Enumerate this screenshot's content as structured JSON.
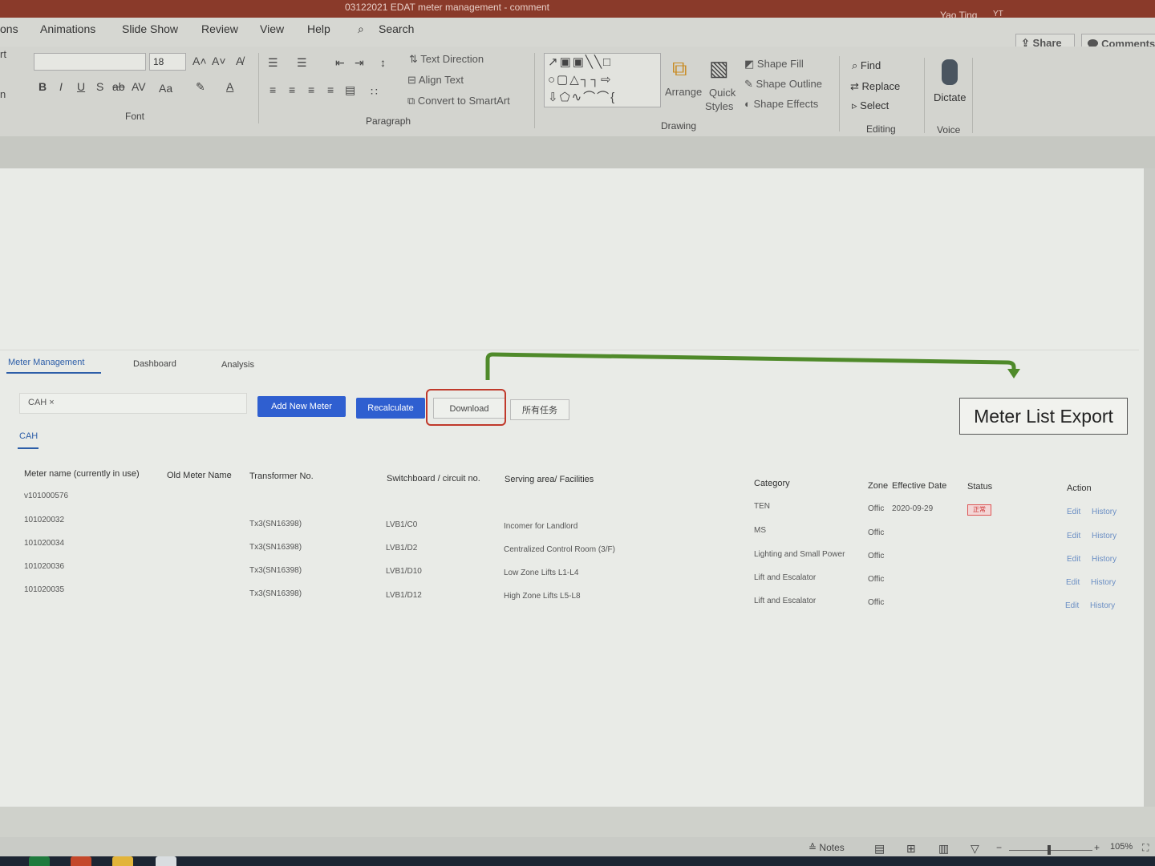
{
  "window": {
    "title": "03122021 EDAT meter management - comment",
    "user": "Yao Ting",
    "user_initials": "YT"
  },
  "ribbon_tabs": [
    "ons",
    "Animations",
    "Slide Show",
    "Review",
    "View",
    "Help",
    "Search"
  ],
  "share": "Share",
  "comments": "Comments",
  "ribbon": {
    "font_size": "18",
    "groups": {
      "font": "Font",
      "paragraph": "Paragraph",
      "drawing": "Drawing",
      "editing": "Editing",
      "voice": "Voice"
    },
    "paragraph_items": [
      "Text Direction",
      "Align Text",
      "Convert to SmartArt"
    ],
    "drawing_items": {
      "arrange": "Arrange",
      "quick": "Quick",
      "styles": "Styles",
      "shape_fill": "Shape Fill",
      "shape_outline": "Shape Outline",
      "shape_effects": "Shape Effects"
    },
    "editing_items": [
      "Find",
      "Replace",
      "Select"
    ],
    "dictate": "Dictate",
    "left_stub_1": "rt",
    "left_stub_2": "n"
  },
  "app": {
    "tabs": [
      "Meter Management",
      "Dashboard",
      "Analysis"
    ],
    "filter_chip": "CAH ×",
    "buttons": {
      "add": "Add New Meter",
      "recalc": "Recalculate",
      "download": "Download",
      "task": "所有任务"
    },
    "subtab": "CAH",
    "callout": "Meter List Export",
    "columns": [
      "Meter name (currently in use)",
      "Old Meter Name",
      "Transformer No.",
      "Switchboard / circuit no.",
      "Serving area/ Facilities",
      "Category",
      "Zone",
      "Effective Date",
      "Status",
      "Action"
    ],
    "rows": [
      {
        "name": "v101000576",
        "transformer": "",
        "switchboard": "",
        "serving": "",
        "category": "TEN",
        "zone": "Offic",
        "date": "2020-09-29",
        "status": "正常",
        "edit": "Edit",
        "history": "History"
      },
      {
        "name": "101020032",
        "transformer": "Tx3(SN16398)",
        "switchboard": "LVB1/C0",
        "serving": "Incomer for Landlord",
        "category": "MS",
        "zone": "Offic",
        "date": "",
        "status": "",
        "edit": "Edit",
        "history": "History"
      },
      {
        "name": "101020034",
        "transformer": "Tx3(SN16398)",
        "switchboard": "LVB1/D2",
        "serving": "Centralized Control Room (3/F)",
        "category": "Lighting and Small Power",
        "zone": "Offic",
        "date": "",
        "status": "",
        "edit": "Edit",
        "history": "History"
      },
      {
        "name": "101020036",
        "transformer": "Tx3(SN16398)",
        "switchboard": "LVB1/D10",
        "serving": "Low Zone Lifts L1-L4",
        "category": "Lift and Escalator",
        "zone": "Offic",
        "date": "",
        "status": "",
        "edit": "Edit",
        "history": "History"
      },
      {
        "name": "101020035",
        "transformer": "Tx3(SN16398)",
        "switchboard": "LVB1/D12",
        "serving": "High Zone Lifts L5-L8",
        "category": "Lift and Escalator",
        "zone": "Offic",
        "date": "",
        "status": "",
        "edit": "Edit",
        "history": "History"
      }
    ]
  },
  "statusbar": {
    "notes": "Notes",
    "zoom": "105%"
  }
}
